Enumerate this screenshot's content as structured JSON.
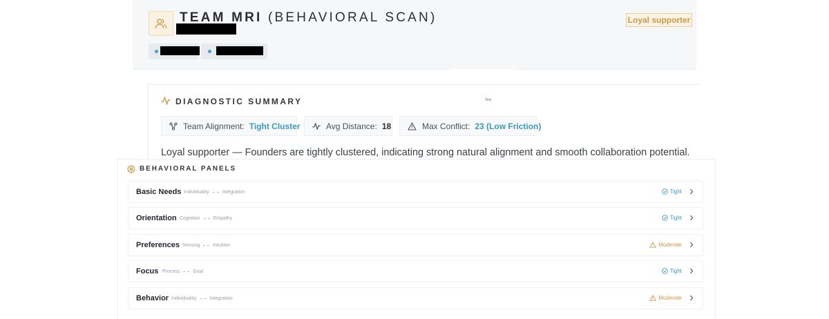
{
  "header": {
    "team_name": "TEAM MRI",
    "scan_type": "(BEHAVIORAL SCAN)",
    "badge": "Loyal supporter",
    "icons": {
      "avatar": "users-icon"
    }
  },
  "diagnostic": {
    "title": "DIAGNOSTIC SUMMARY",
    "tiny_label": "Text",
    "metrics": [
      {
        "icon": "cluster-icon",
        "label": "Team Alignment:",
        "value": "Tight Cluster"
      },
      {
        "icon": "pulse-icon",
        "label": "Avg Distance:",
        "value": "18"
      },
      {
        "icon": "warning-triangle-icon",
        "label": "Max Conflict:",
        "value": "23 (Low Friction)"
      }
    ],
    "summary": "Loyal supporter — Founders are tightly clustered, indicating strong natural alignment and smooth collaboration potential."
  },
  "panels": {
    "title": "BEHAVIORAL PANELS",
    "items": [
      {
        "name": "Basic Needs",
        "from": "Individuality",
        "to": "Integration",
        "status": "Tight"
      },
      {
        "name": "Orientation",
        "from": "Cognition",
        "to": "Empathy",
        "status": "Tight"
      },
      {
        "name": "Preferences",
        "from": "Sensing",
        "to": "Intuition",
        "status": "Moderate"
      },
      {
        "name": "Focus",
        "from": "Process",
        "to": "Goal",
        "status": "Tight"
      },
      {
        "name": "Behavior",
        "from": "Individuality",
        "to": "Integration",
        "status": "Moderate"
      }
    ]
  },
  "colors": {
    "accent_blue": "#3d98bb",
    "accent_gold": "#c99a4a",
    "badge_bg": "#fcf3e4"
  }
}
